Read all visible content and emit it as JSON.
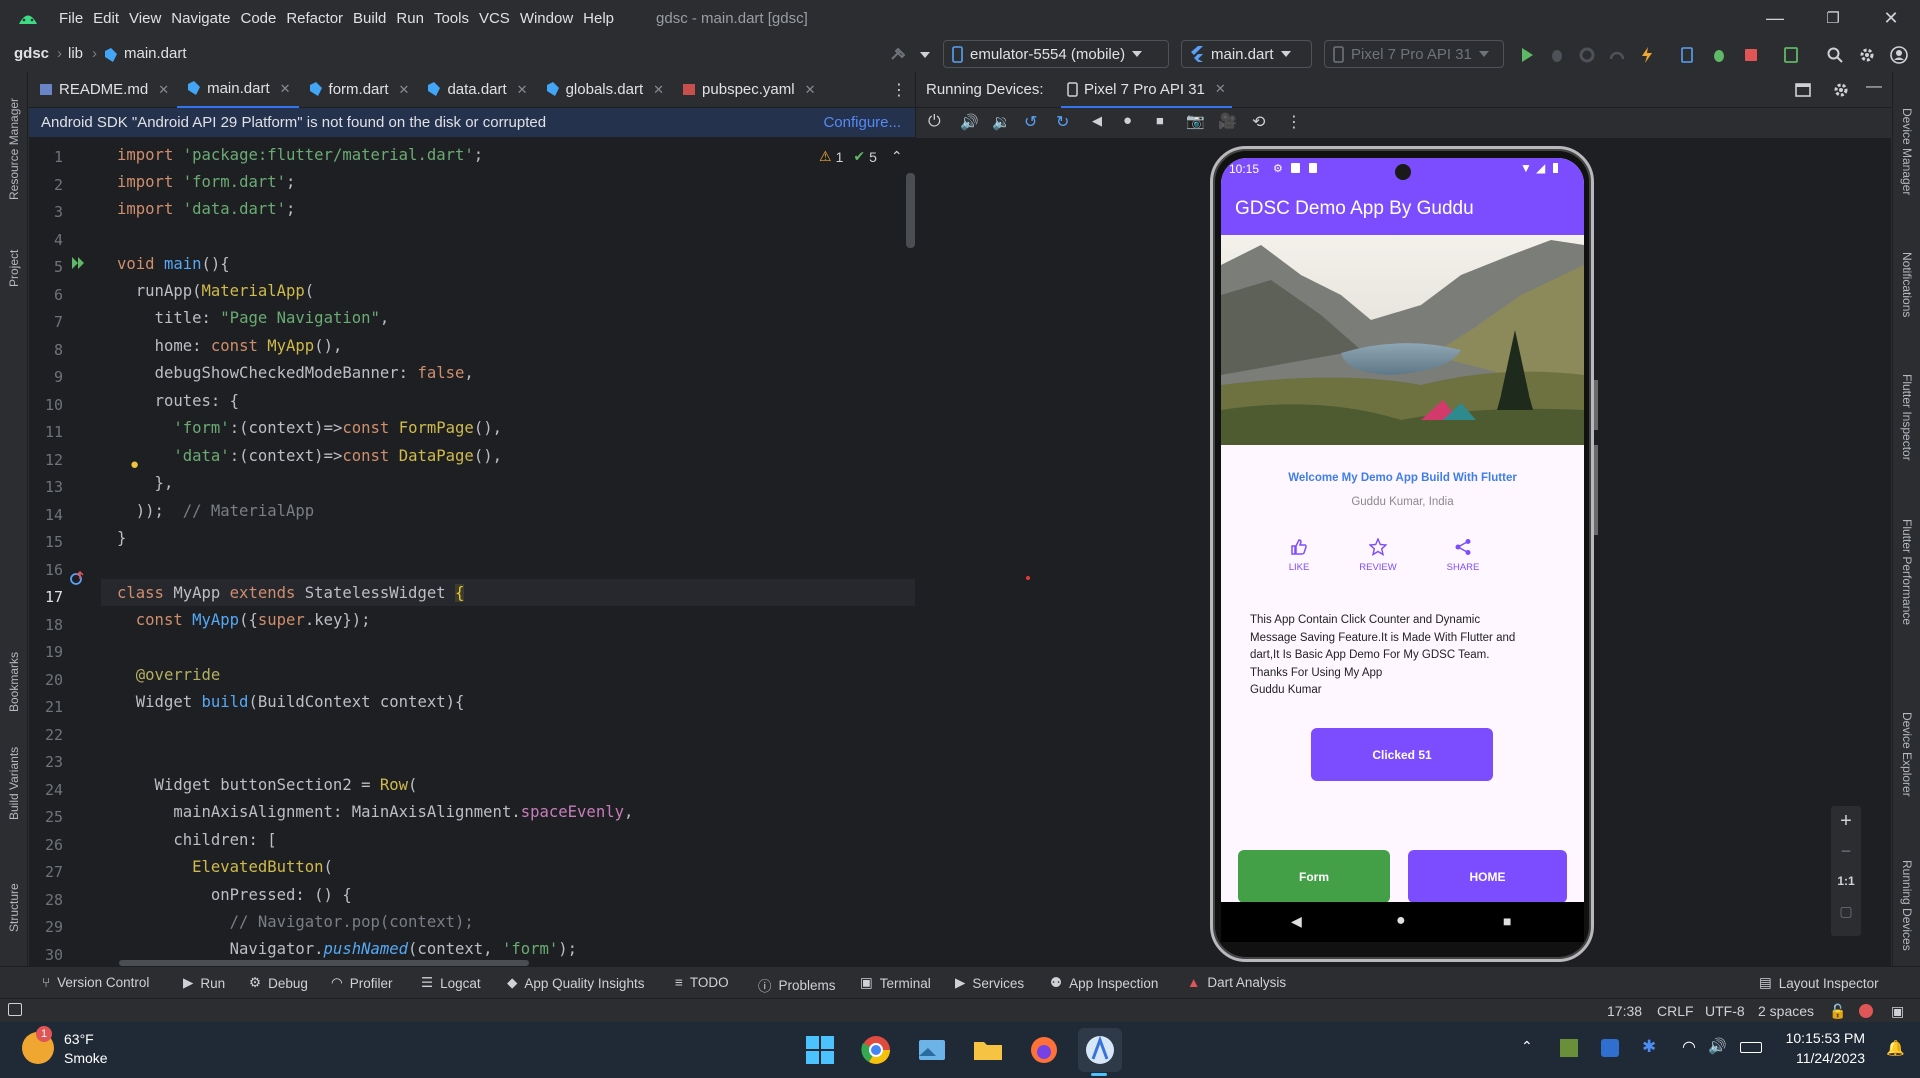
{
  "menu": {
    "items": [
      "File",
      "Edit",
      "View",
      "Navigate",
      "Code",
      "Refactor",
      "Build",
      "Run",
      "Tools",
      "VCS",
      "Window",
      "Help"
    ],
    "window_title": "gdsc - main.dart [gdsc]"
  },
  "nav": {
    "project": "gdsc",
    "folder": "lib",
    "file": "main.dart",
    "device_combo": "emulator-5554 (mobile)",
    "run_config": "main.dart",
    "avd_combo": "Pixel 7 Pro API 31"
  },
  "left_stripe": [
    "Resource Manager",
    "Project",
    "Bookmarks",
    "Build Variants",
    "Structure"
  ],
  "right_stripe": [
    "Device Manager",
    "Notifications",
    "Flutter Inspector",
    "Flutter Performance",
    "Device Explorer",
    "Running Devices"
  ],
  "editor_tabs": [
    "README.md",
    "main.dart",
    "form.dart",
    "data.dart",
    "globals.dart",
    "pubspec.yaml"
  ],
  "notice": {
    "text": "Android SDK \"Android API 29 Platform\" is not found on the disk or corrupted",
    "link": "Configure..."
  },
  "inspections": {
    "warnings": "1",
    "ok": "5"
  },
  "line_numbers": [
    "1",
    "2",
    "3",
    "4",
    "5",
    "6",
    "7",
    "8",
    "9",
    "10",
    "11",
    "12",
    "13",
    "14",
    "15",
    "16",
    "17",
    "18",
    "19",
    "20",
    "21",
    "22",
    "23",
    "24",
    "25",
    "26",
    "27",
    "28",
    "29",
    "30"
  ],
  "running_devices": {
    "label": "Running Devices:",
    "tab": "Pixel 7 Pro API 31"
  },
  "phone": {
    "time": "10:15",
    "app_title": "GDSC Demo App By Guddu",
    "welcome": "Welcome My Demo App Build With Flutter",
    "author": "Guddu Kumar, India",
    "actions": [
      "LIKE",
      "REVIEW",
      "SHARE"
    ],
    "description_lines": [
      "This App Contain Click Counter and Dynamic",
      "Message Saving Feature.It is Made With Flutter and",
      "dart,It Is Basic App  Demo For My GDSC Team.",
      "Thanks For Using My App",
      "Guddu Kumar"
    ],
    "clicked_label": "Clicked 51",
    "form_label": "Form",
    "home_label": "HOME"
  },
  "zoom_controls": [
    "+",
    "−",
    "1:1"
  ],
  "bottom_tools": [
    "Version Control",
    "Run",
    "Debug",
    "Profiler",
    "Logcat",
    "App Quality Insights",
    "TODO",
    "Problems",
    "Terminal",
    "Services",
    "App Inspection",
    "Dart Analysis",
    "Layout Inspector"
  ],
  "status": {
    "position": "17:38",
    "line_sep": "CRLF",
    "encoding": "UTF-8",
    "indent": "2 spaces"
  },
  "taskbar": {
    "temp": "63°F",
    "weather": "Smoke",
    "badge": "1",
    "time": "10:15:53 PM",
    "date": "11/24/2023"
  },
  "colors": {
    "app_purple": "#7c4dff",
    "form_green": "#43a047",
    "ide_bg": "#2b2d30",
    "editor_bg": "#1e1f22",
    "notice_bg": "#25324d",
    "accent_blue": "#3574f0"
  }
}
